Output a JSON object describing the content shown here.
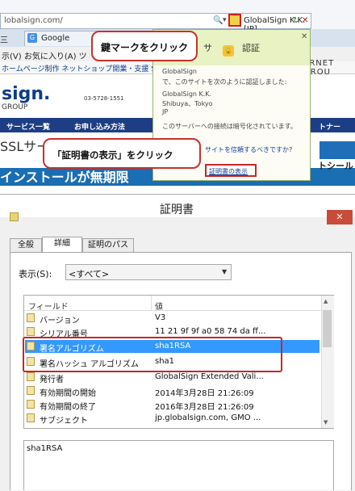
{
  "browser": {
    "url": "lobalsign.com/",
    "addr_search_icon": "🔍",
    "addr_dropdown": "▾",
    "site_identity": "GlobalSign K.K. [JP]",
    "refresh_icon": "↻",
    "stop_icon": "✕",
    "tab_partial": "三",
    "tab_google": "Google",
    "menu": "示(V)   お気に入り(A)   ツ",
    "favorites": "ホームページ制作   ネットショップ開業・支援   SSL",
    "brand_right": "ERNET GROU",
    "logo": "sign.",
    "logo_sub": "GROUP",
    "phone": "03-5728-1551",
    "nav": [
      "サービス一覧",
      "お申し込み方法",
      "トナー"
    ],
    "ssl_text": "SSLサー",
    "install_text": "インストールが無期限",
    "seal_text": "トシール"
  },
  "popup": {
    "title": "認証",
    "title_prefix": "サ",
    "close": "✕",
    "lines": [
      "GlobalSign",
      "で、このサイトを次のように認証しました:",
      "GlobalSign K.K.",
      "Shibuya、Tokyo",
      "JP",
      "このサーバーへの接続は暗号化されています。"
    ],
    "trust_link": "サイトを信頼するべきですか?",
    "view_cert_link": "証明書の表示"
  },
  "callouts": {
    "lock": "鍵マークをクリック",
    "view_cert": "「証明書の表示」をクリック"
  },
  "dialog": {
    "title": "証明書",
    "close": "✕",
    "tabs": [
      "全般",
      "詳細",
      "証明のパス"
    ],
    "show_label": "表示(S):",
    "show_value": "<すべて>",
    "columns": [
      "フィールド",
      "値"
    ],
    "rows": [
      {
        "field": "バージョン",
        "value": "V3"
      },
      {
        "field": "シリアル番号",
        "value": "11 21 9f 9f a0 58 74 da ff..."
      },
      {
        "field": "署名アルゴリズム",
        "value": "sha1RSA"
      },
      {
        "field": "署名ハッシュ アルゴリズム",
        "value": "sha1"
      },
      {
        "field": "発行者",
        "value": "GlobalSign Extended Vali..."
      },
      {
        "field": "有効期間の開始",
        "value": "2014年3月28日 21:26:09"
      },
      {
        "field": "有効期間の終了",
        "value": "2016年3月28日 21:26:09"
      },
      {
        "field": "サブジェクト",
        "value": "jp.globalsign.com, GMO ..."
      }
    ],
    "detail_value": "sha1RSA"
  }
}
